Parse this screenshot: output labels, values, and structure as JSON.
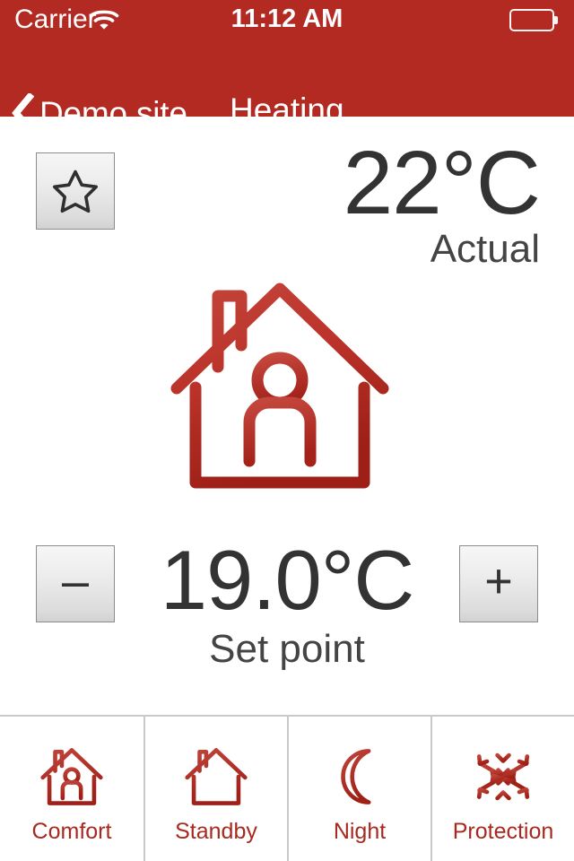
{
  "theme": {
    "brand_red": "#b22a22",
    "label_red": "#a8291f",
    "text_dark": "#333333",
    "divider_gray": "#c9c9c9"
  },
  "status_bar": {
    "carrier": "Carrier",
    "wifi_icon": "wifi-icon",
    "time": "11:12 AM",
    "battery_icon": "battery-icon"
  },
  "nav_bar": {
    "back_icon": "chevron-left-icon",
    "back_label": "Demo site",
    "title": "Heating"
  },
  "main": {
    "favorite_button": {
      "icon": "star-icon",
      "active": false
    },
    "actual": {
      "value": "22°C",
      "label": "Actual"
    },
    "hero_icon": "house-with-person-icon",
    "setpoint": {
      "decrease_label": "–",
      "increase_label": "+",
      "value": "19.0°C",
      "label": "Set point"
    }
  },
  "toolbar": {
    "items": [
      {
        "label": "Comfort",
        "icon": "house-with-person-icon"
      },
      {
        "label": "Standby",
        "icon": "house-icon"
      },
      {
        "label": "Night",
        "icon": "moon-icon"
      },
      {
        "label": "Protection",
        "icon": "snowflake-icon"
      }
    ]
  }
}
